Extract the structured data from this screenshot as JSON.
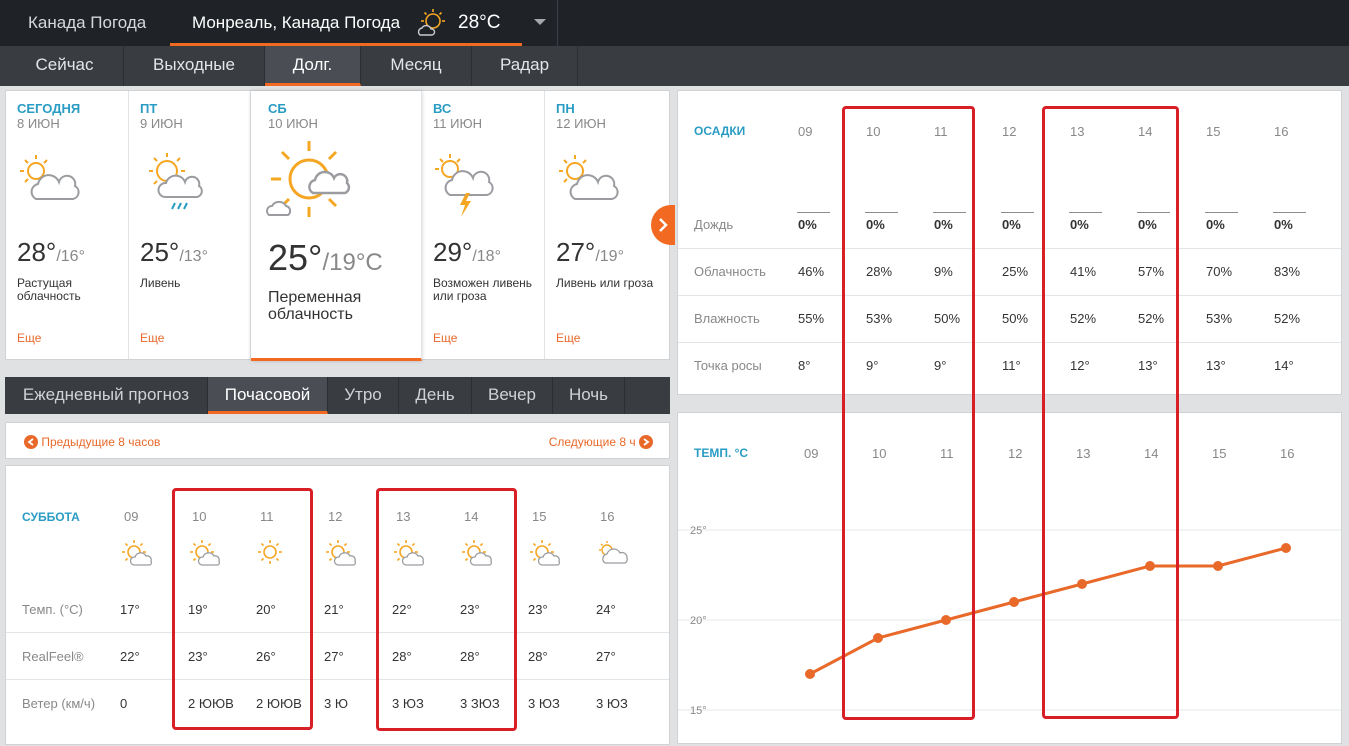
{
  "topbar": {
    "country_tab": "Канада Погода",
    "city_tab": "Монреаль, Канада Погода",
    "current_temp": "28°C"
  },
  "nav": {
    "tabs": [
      {
        "label": "Сейчас"
      },
      {
        "label": "Выходные"
      },
      {
        "label": "Долг."
      },
      {
        "label": "Месяц"
      },
      {
        "label": "Радар"
      }
    ],
    "active_index": 2
  },
  "days": [
    {
      "name": "СЕГОДНЯ",
      "date": "8 ИЮН",
      "high": "28°",
      "low": "/16°",
      "phrase": "Растущая облачность",
      "more": "Еще",
      "icon": "partly-cloudy-icon"
    },
    {
      "name": "ПТ",
      "date": "9 ИЮН",
      "high": "25°",
      "low": "/13°",
      "phrase": "Ливень",
      "more": "Еще",
      "icon": "showers-icon"
    },
    {
      "name": "СБ",
      "date": "10 ИЮН",
      "high": "25°",
      "low": "/19°C",
      "phrase": "Переменная облачность",
      "more": "",
      "icon": "sun-cloud-icon"
    },
    {
      "name": "ВС",
      "date": "11 ИЮН",
      "high": "29°",
      "low": "/18°",
      "phrase": "Возможен ливень или гроза",
      "more": "Еще",
      "icon": "thunder-icon"
    },
    {
      "name": "ПН",
      "date": "12 ИЮН",
      "high": "27°",
      "low": "/19°",
      "phrase": "Ливень или гроза",
      "more": "Еще",
      "icon": "partly-cloudy-icon"
    }
  ],
  "subnav": {
    "tabs": [
      {
        "label": "Ежедневный прогноз"
      },
      {
        "label": "Почасовой"
      },
      {
        "label": "Утро"
      },
      {
        "label": "День"
      },
      {
        "label": "Вечер"
      },
      {
        "label": "Ночь"
      }
    ],
    "active_index": 1
  },
  "pager": {
    "prev": "Предыдущие 8 часов",
    "next": "Следующие 8 ч"
  },
  "hourly": {
    "title": "СУББОТА",
    "hours": [
      "09",
      "10",
      "11",
      "12",
      "13",
      "14",
      "15",
      "16"
    ],
    "icons": [
      "sun-cloud-icon",
      "sun-cloud-icon",
      "sun-icon",
      "sun-cloud-icon",
      "sun-cloud-icon",
      "sun-cloud-icon",
      "sun-cloud-icon",
      "cloudy-icon"
    ],
    "rows": [
      {
        "label": "Темп. (°C)",
        "values": [
          "17°",
          "19°",
          "20°",
          "21°",
          "22°",
          "23°",
          "23°",
          "24°"
        ]
      },
      {
        "label": "RealFeel®",
        "values": [
          "22°",
          "23°",
          "26°",
          "27°",
          "28°",
          "28°",
          "28°",
          "27°"
        ]
      },
      {
        "label": "Ветер (км/ч)",
        "values": [
          "0",
          "2 ЮЮВ",
          "2 ЮЮВ",
          "3 Ю",
          "3 ЮЗ",
          "3 ЗЮЗ",
          "3 ЮЗ",
          "3 ЮЗ"
        ]
      }
    ]
  },
  "precip": {
    "title": "ОСАДКИ",
    "hours": [
      "09",
      "10",
      "11",
      "12",
      "13",
      "14",
      "15",
      "16"
    ],
    "rows": [
      {
        "label": "Дождь",
        "values": [
          "0%",
          "0%",
          "0%",
          "0%",
          "0%",
          "0%",
          "0%",
          "0%"
        ]
      },
      {
        "label": "Облачность",
        "values": [
          "46%",
          "28%",
          "9%",
          "25%",
          "41%",
          "57%",
          "70%",
          "83%"
        ]
      },
      {
        "label": "Влажность",
        "values": [
          "55%",
          "53%",
          "50%",
          "50%",
          "52%",
          "52%",
          "53%",
          "52%"
        ]
      },
      {
        "label": "Точка росы",
        "values": [
          "8°",
          "9°",
          "9°",
          "11°",
          "12°",
          "13°",
          "13°",
          "14°"
        ]
      }
    ]
  },
  "chart_data": {
    "type": "line",
    "title": "ТЕМП. °C",
    "x": [
      "09",
      "10",
      "11",
      "12",
      "13",
      "14",
      "15",
      "16"
    ],
    "series": [
      {
        "values": [
          17,
          19,
          20,
          21,
          22,
          23,
          23,
          24
        ]
      }
    ],
    "yticks": [
      "25°",
      "20°",
      "15°"
    ],
    "ylim": [
      15,
      25
    ],
    "color": "#e8692a",
    "grid": true
  },
  "colors": {
    "accent": "#f26a21",
    "link": "#e8692a",
    "title": "#2a9cc4",
    "highlight": "#d91f26"
  }
}
